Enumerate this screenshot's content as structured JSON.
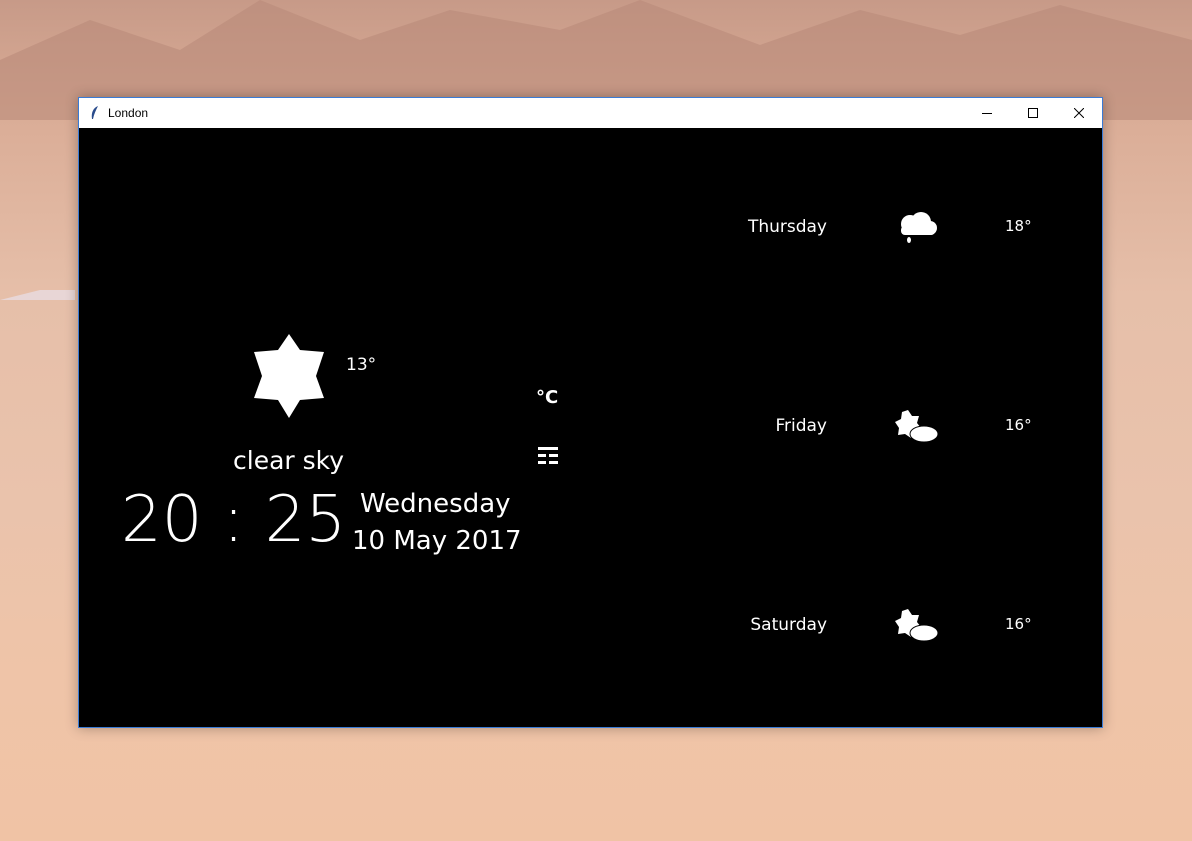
{
  "window": {
    "title": "London"
  },
  "current": {
    "icon": "sun-icon",
    "temperature": "13°",
    "description": "clear sky",
    "time_hours": "20",
    "time_sep": ":",
    "time_minutes": "25",
    "weekday": "Wednesday",
    "date": "10 May 2017"
  },
  "controls": {
    "unit_label": "°C",
    "menu_icon": "menu-icon"
  },
  "forecast": [
    {
      "day": "Thursday",
      "icon": "cloud-rain-icon",
      "temperature": "18°"
    },
    {
      "day": "Friday",
      "icon": "partly-cloudy-icon",
      "temperature": "16°"
    },
    {
      "day": "Saturday",
      "icon": "partly-cloudy-icon",
      "temperature": "16°"
    }
  ]
}
